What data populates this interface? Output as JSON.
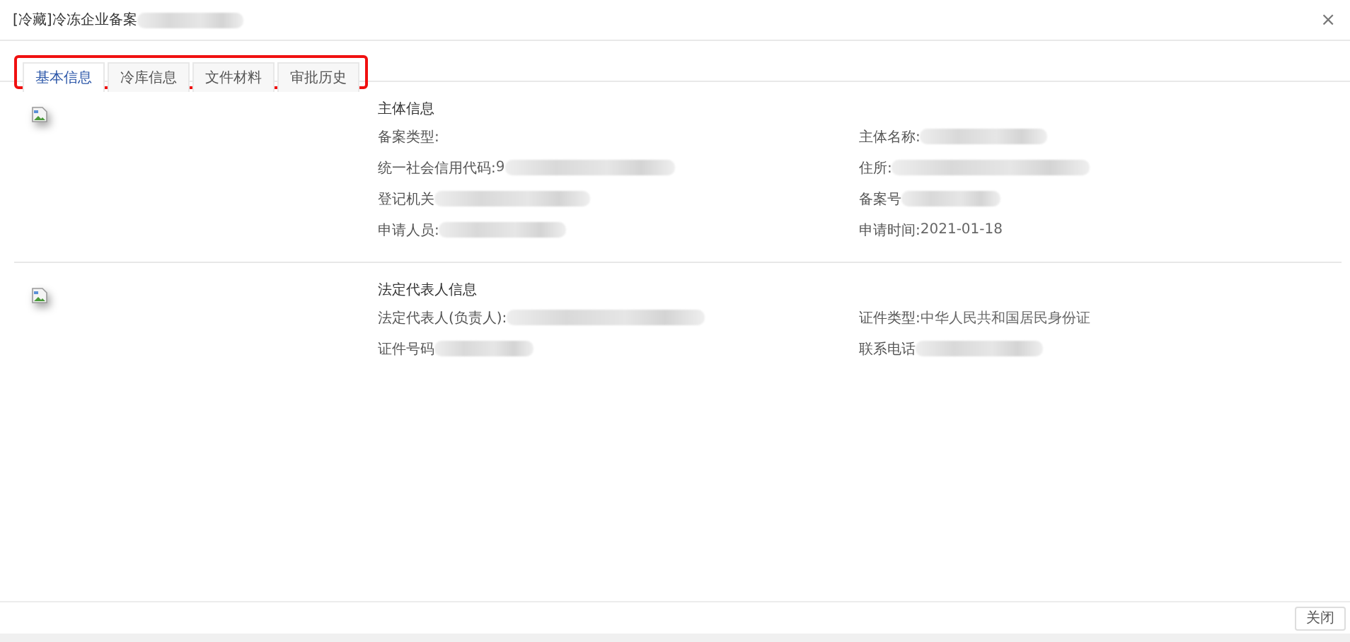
{
  "window": {
    "title": "[冷藏]冷冻企业备案",
    "title_redacted": true,
    "close": "×"
  },
  "tabs": [
    {
      "label": "基本信息",
      "selected": true
    },
    {
      "label": "冷库信息",
      "selected": false
    },
    {
      "label": "文件材料",
      "selected": false
    },
    {
      "label": "审批历史",
      "selected": false
    }
  ],
  "tabs_highlighted": true,
  "sections": [
    {
      "heading": "主体信息",
      "fields": [
        {
          "label": "备案类型:",
          "redacted": false
        },
        {
          "label": "主体名称:",
          "redacted": true
        },
        {
          "label": "统一社会信用代码:",
          "value": "9",
          "redacted": true
        },
        {
          "label": "住所:",
          "redacted": true
        },
        {
          "label": "登记机关",
          "redacted": true
        },
        {
          "label": "备案号",
          "redacted": true
        },
        {
          "label": "申请人员:",
          "redacted": true
        },
        {
          "label": "申请时间:",
          "value": "2021-01-18",
          "redacted": false
        }
      ]
    },
    {
      "heading": "法定代表人信息",
      "fields": [
        {
          "label": "法定代表人(负责人):",
          "redacted": true
        },
        {
          "label": "证件类型:",
          "value": "中华人民共和国居民身份证",
          "redacted": false
        },
        {
          "label": "证件号码",
          "redacted": true
        },
        {
          "label": "联系电话",
          "redacted": true
        }
      ]
    }
  ],
  "footer": {
    "button": "关闭"
  }
}
